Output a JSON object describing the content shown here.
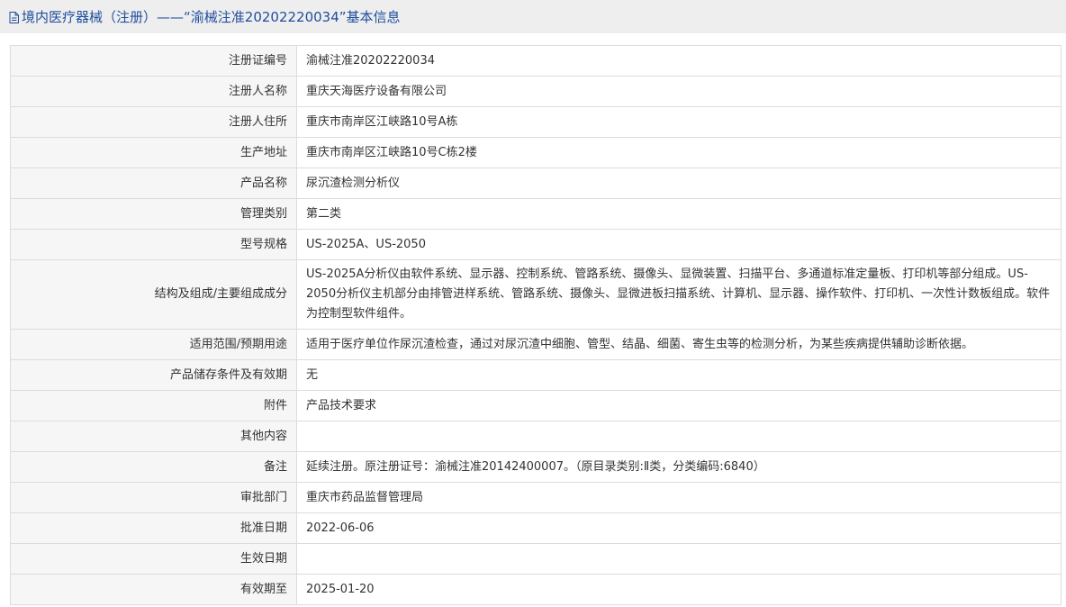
{
  "header": {
    "title": "境内医疗器械（注册）——“渝械注准20202220034”基本信息",
    "icon": "document-icon",
    "color": "#1f4e9e"
  },
  "rows": [
    {
      "label": "注册证编号",
      "value": "渝械注准20202220034"
    },
    {
      "label": "注册人名称",
      "value": "重庆天海医疗设备有限公司"
    },
    {
      "label": "注册人住所",
      "value": "重庆市南岸区江峡路10号A栋"
    },
    {
      "label": "生产地址",
      "value": "重庆市南岸区江峡路10号C栋2楼"
    },
    {
      "label": "产品名称",
      "value": "尿沉渣检测分析仪"
    },
    {
      "label": "管理类别",
      "value": "第二类"
    },
    {
      "label": "型号规格",
      "value": "US-2025A、US-2050"
    },
    {
      "label": "结构及组成/主要组成成分",
      "value": "US-2025A分析仪由软件系统、显示器、控制系统、管路系统、摄像头、显微装置、扫描平台、多通道标准定量板、打印机等部分组成。US-2050分析仪主机部分由排管进样系统、管路系统、摄像头、显微进板扫描系统、计算机、显示器、操作软件、打印机、一次性计数板组成。软件为控制型软件组件。"
    },
    {
      "label": "适用范围/预期用途",
      "value": "适用于医疗单位作尿沉渣检查，通过对尿沉渣中细胞、管型、结晶、细菌、寄生虫等的检测分析，为某些疾病提供辅助诊断依据。"
    },
    {
      "label": "产品储存条件及有效期",
      "value": "无"
    },
    {
      "label": "附件",
      "value": "产品技术要求"
    },
    {
      "label": "其他内容",
      "value": ""
    },
    {
      "label": "备注",
      "value": "延续注册。原注册证号：渝械注准20142400007。（原目录类别:Ⅱ类，分类编码:6840）"
    },
    {
      "label": "审批部门",
      "value": "重庆市药品监督管理局"
    },
    {
      "label": "批准日期",
      "value": "2022-06-06"
    },
    {
      "label": "生效日期",
      "value": ""
    },
    {
      "label": "有效期至",
      "value": "2025-01-20"
    }
  ]
}
